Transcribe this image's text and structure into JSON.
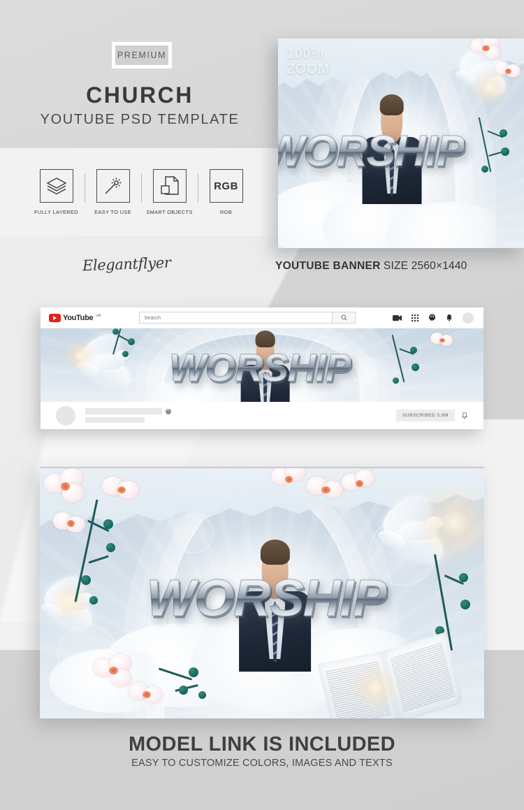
{
  "header": {
    "badge": "PREMIUM",
    "title": "CHURCH",
    "subtitle": "YOUTUBE PSD TEMPLATE"
  },
  "features": [
    {
      "label": "FULLY LAYERED",
      "icon": "layers-icon"
    },
    {
      "label": "EASY TO USE",
      "icon": "magic-wand-icon"
    },
    {
      "label": "SMART OBJECTS",
      "icon": "smart-objects-icon"
    },
    {
      "label": "RGB",
      "icon": "rgb-icon",
      "boxtext": "RGB"
    }
  ],
  "brand": {
    "name": "Elegantflyer"
  },
  "banner_meta": {
    "title": "YOUTUBE BANNER",
    "size": "SIZE 2560×1440"
  },
  "zoom_preview": {
    "line1": "100%",
    "line2": "ZOOM"
  },
  "artwork": {
    "headline": "WORSHIP"
  },
  "youtube": {
    "logo_text": "YouTube",
    "logo_region": "UA",
    "search_placeholder": "Search",
    "icons": [
      "create-video-icon",
      "apps-grid-icon",
      "messages-icon",
      "notifications-bell-icon",
      "account-avatar"
    ],
    "subscribe_label": "SUBSCRIBED  5.8M",
    "bell_icon": "notification-bell-icon"
  },
  "footer": {
    "line1": "MODEL LINK IS INCLUDED",
    "line2": "EASY TO CUSTOMIZE COLORS, IMAGES AND TEXTS"
  },
  "colors": {
    "page_bg": "#d4d4d4",
    "band_bg": "#f2f2f2",
    "youtube_red": "#e62117",
    "text_dark": "#3a3a3a",
    "orchid_pink": "#f3dde2",
    "leaf_green": "#1f5b57"
  }
}
